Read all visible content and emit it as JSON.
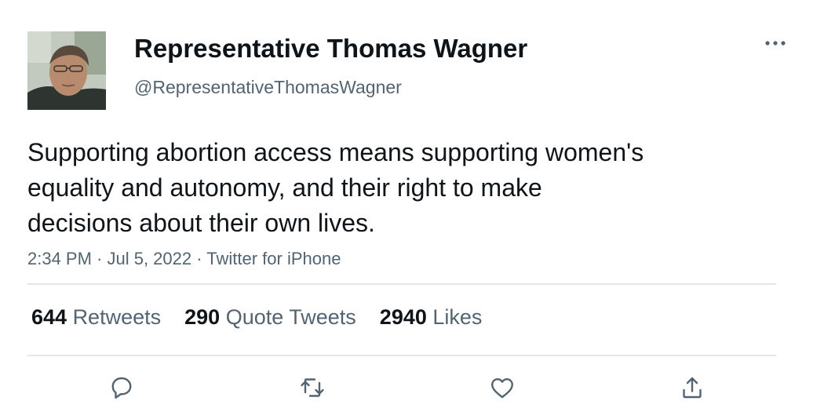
{
  "author": {
    "display_name": "Representative Thomas Wagner",
    "handle": "@RepresentativeThomasWagner",
    "avatar_icon": "profile-photo"
  },
  "tweet": {
    "text_lines": [
      "Supporting abortion access means supporting women's",
      "equality and autonomy, and their right to make",
      "decisions about their own lives."
    ],
    "meta": "2:34 PM · Jul 5, 2022 · Twitter for iPhone"
  },
  "stats": {
    "retweets": {
      "count": "644",
      "label": "Retweets"
    },
    "quotes": {
      "count": "290",
      "label": "Quote Tweets"
    },
    "likes": {
      "count": "2940",
      "label": "Likes"
    }
  },
  "actions": [
    "reply-icon",
    "retweet-icon",
    "like-icon",
    "share-icon"
  ],
  "colors": {
    "text": "#0f1419",
    "secondary": "#536471",
    "divider": "#e1e6e9"
  }
}
